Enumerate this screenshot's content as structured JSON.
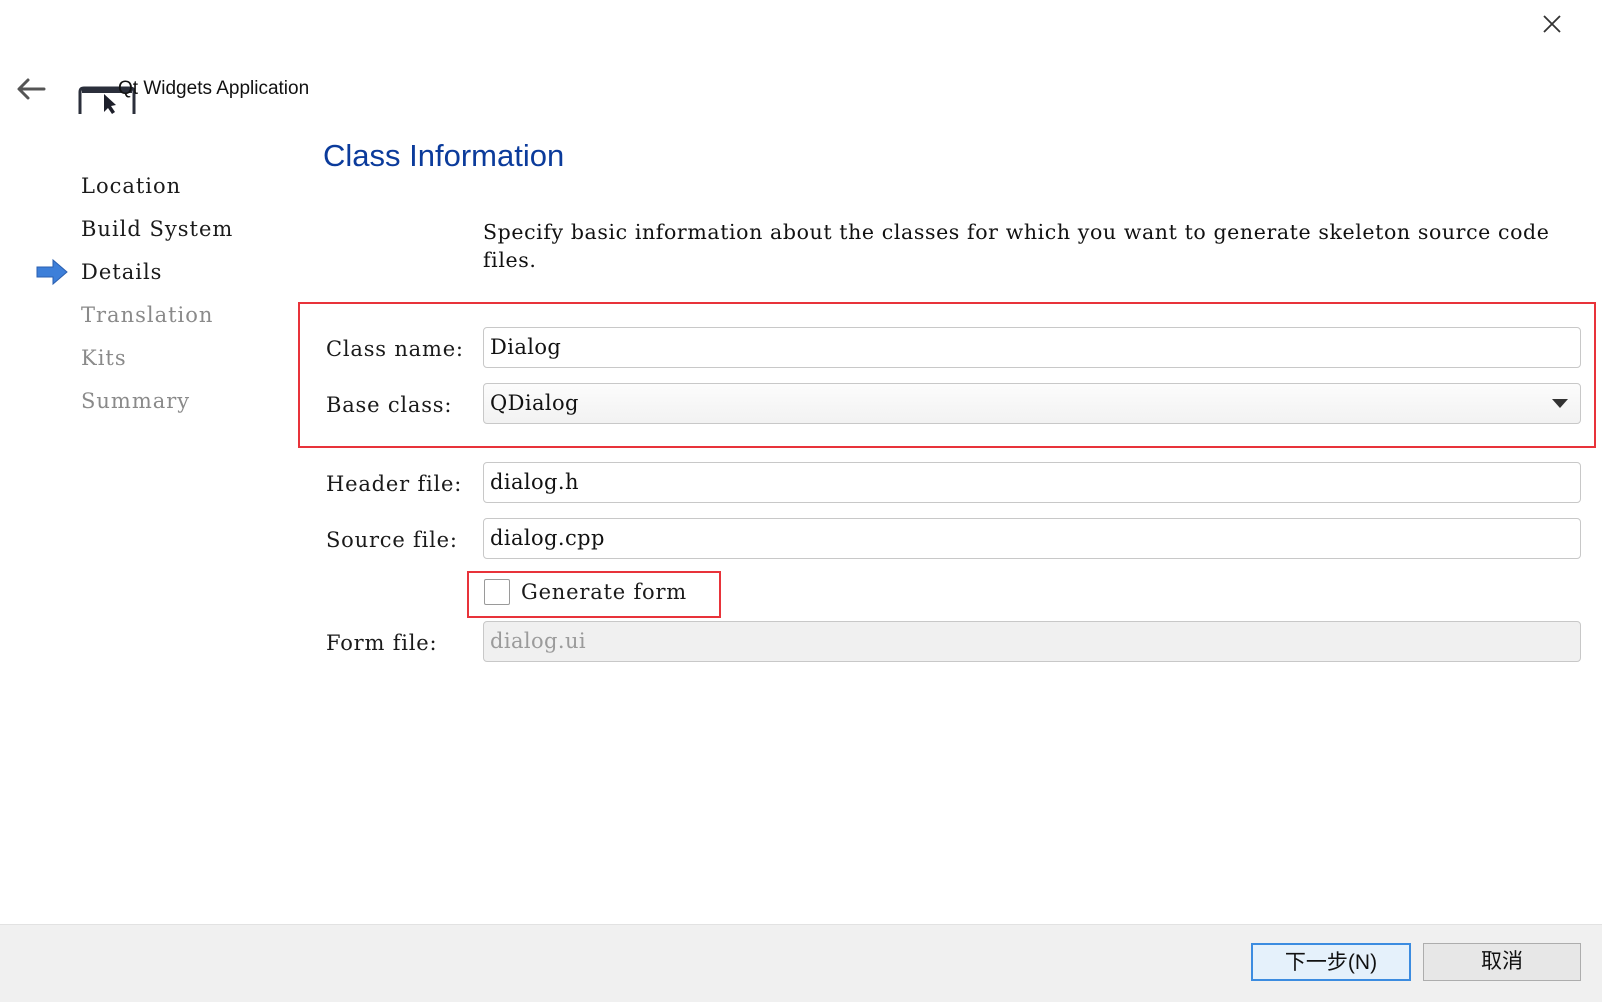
{
  "window": {
    "title": "Qt Widgets Application",
    "close_icon": "close-icon",
    "back_icon": "back-arrow-icon"
  },
  "steps": [
    {
      "label": "Location",
      "state": "done"
    },
    {
      "label": "Build System",
      "state": "done"
    },
    {
      "label": "Details",
      "state": "current"
    },
    {
      "label": "Translation",
      "state": "todo"
    },
    {
      "label": "Kits",
      "state": "todo"
    },
    {
      "label": "Summary",
      "state": "todo"
    }
  ],
  "page": {
    "heading": "Class Information",
    "description": "Specify basic information about the classes for which you want to generate skeleton source code files."
  },
  "form": {
    "class_name_label": "Class name:",
    "class_name_value": "Dialog",
    "base_class_label": "Base class:",
    "base_class_value": "QDialog",
    "header_file_label": "Header file:",
    "header_file_value": "dialog.h",
    "source_file_label": "Source file:",
    "source_file_value": "dialog.cpp",
    "generate_form_label": "Generate form",
    "generate_form_checked": false,
    "form_file_label": "Form file:",
    "form_file_value": "dialog.ui",
    "form_file_enabled": false
  },
  "footer": {
    "next_label": "下一步(N)",
    "cancel_label": "取消"
  },
  "colors": {
    "heading": "#0b3b9b",
    "highlight_frame": "#e8333a",
    "step_arrow": "#3d7fd9"
  }
}
